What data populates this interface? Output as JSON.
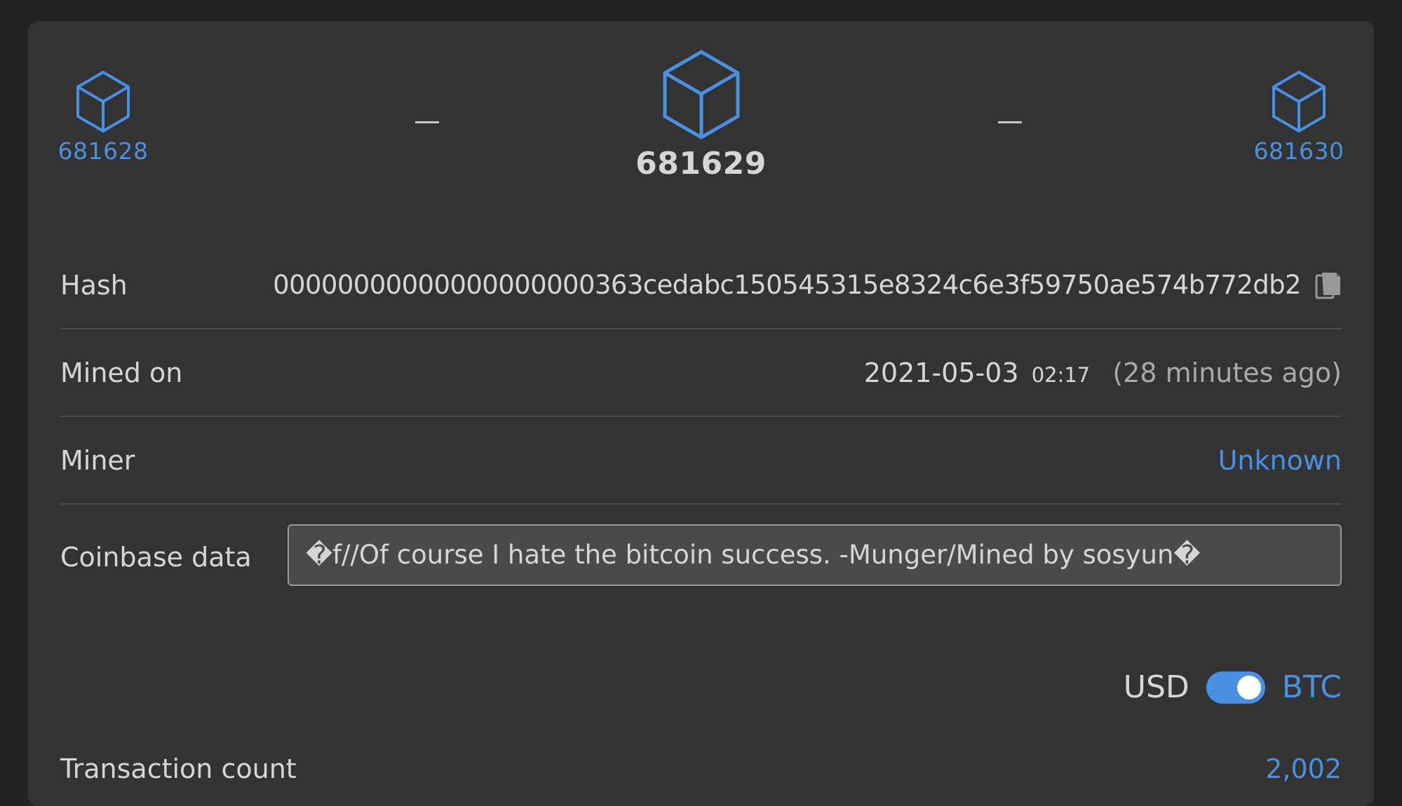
{
  "navigator": {
    "previous_block": "681628",
    "current_block": "681629",
    "next_block": "681630",
    "separator": "–"
  },
  "details": {
    "hash": {
      "label": "Hash",
      "value": "00000000000000000000363cedabc150545315e8324c6e3f59750ae574b772db2"
    },
    "mined_on": {
      "label": "Mined on",
      "date": "2021-05-03",
      "time": "02:17",
      "relative": "(28 minutes ago)"
    },
    "miner": {
      "label": "Miner",
      "value": "Unknown"
    },
    "coinbase": {
      "label": "Coinbase data",
      "value": "�f//Of course I hate the bitcoin success. -Munger/Mined by sosyun�"
    }
  },
  "currency_toggle": {
    "left_label": "USD",
    "right_label": "BTC",
    "selected": "BTC"
  },
  "transaction_count": {
    "label": "Transaction count",
    "value": "2,002"
  },
  "colors": {
    "accent": "#4a90e2",
    "background": "#222222",
    "card": "#333333",
    "text": "#d6d6d6"
  }
}
